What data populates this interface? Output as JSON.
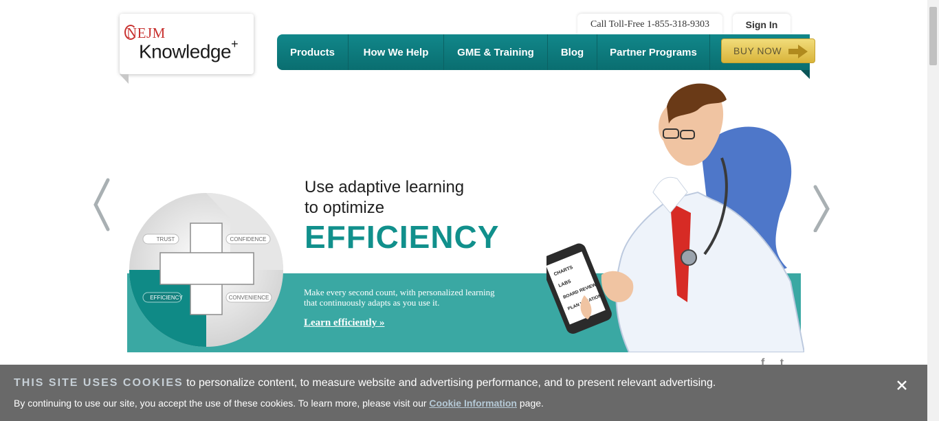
{
  "logo": {
    "brand_top": "NEJM",
    "brand_main": "Knowledge",
    "brand_sup": "+"
  },
  "topbar": {
    "phone": "Call Toll-Free 1-855-318-9303",
    "signin": "Sign In"
  },
  "nav": {
    "items": [
      "Products",
      "How We Help",
      "GME & Training",
      "Blog",
      "Partner Programs"
    ],
    "buy": "BUY NOW"
  },
  "hero": {
    "headline_line1": "Use adaptive learning",
    "headline_line2": "to optimize",
    "headline_big": "EFFICIENCY",
    "blurb": "Make every second count, with personalized learning that continuously adapts as you use it.",
    "cta": "Learn efficiently",
    "cta_suffix": "»",
    "circle_labels": {
      "trust": "TRUST",
      "confidence": "CONFIDENCE",
      "efficiency": "EFFICIENCY",
      "convenience": "CONVENIENCE"
    },
    "phone_list": [
      "CHARTS",
      "LABS",
      "BOARD REVIEW",
      "PLAN VACATION"
    ]
  },
  "social": {
    "facebook": "f",
    "twitter": "t"
  },
  "cookie": {
    "heading": "THIS SITE USES COOKIES",
    "line1_rest": " to personalize content, to measure website and advertising performance, and to present relevant advertising.",
    "line2_pre": "By continuing to use our site, you accept the use of these cookies. To learn more, please visit our ",
    "line2_link": "Cookie Information",
    "line2_post": " page."
  },
  "colors": {
    "teal": "#11908c",
    "nav_teal": "#0a6e70",
    "band_teal": "#3aa8a3",
    "gold": "#d9b43a",
    "cookie_bg": "#696969",
    "nejm_red": "#c8312f"
  }
}
